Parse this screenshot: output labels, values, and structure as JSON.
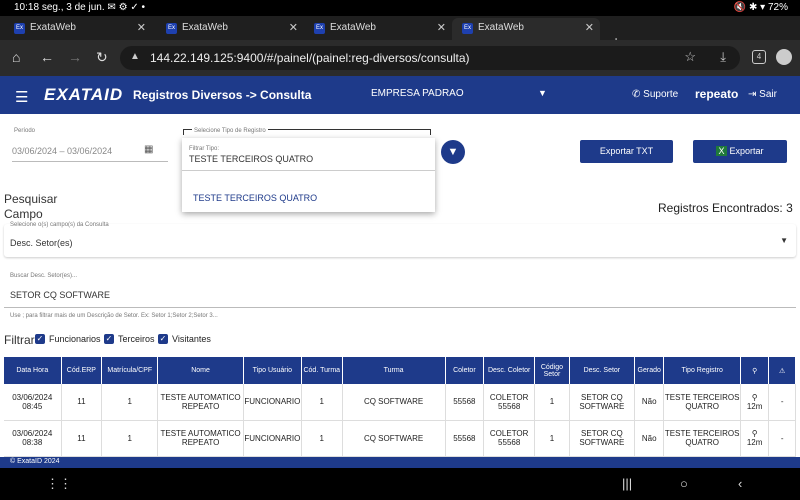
{
  "status": {
    "time": "10:18",
    "date": "seg., 3 de jun.",
    "battery": "72%"
  },
  "browser": {
    "tabs": [
      "ExataWeb",
      "ExataWeb",
      "ExataWeb",
      "ExataWeb"
    ],
    "url": "144.22.149.125:9400/#/painel/(painel:reg-diversos/consulta)",
    "tab_count": "4"
  },
  "app": {
    "logo": "EXATAID",
    "title": "Registros Diversos -> Consulta",
    "company": "EMPRESA PADRAO",
    "support": "Suporte",
    "user": "repeato",
    "logout": "Sair"
  },
  "filters": {
    "period_label": "Período",
    "period_value": "03/06/2024 – 03/06/2024",
    "type_label": "Selecione Tipo de Registro",
    "filter_label": "Filtrar Tipo:",
    "filter_value": "TESTE TERCEIROS QUATRO",
    "option": "TESTE TERCEIROS QUATRO",
    "export_txt": "Exportar TXT",
    "export": "Exportar"
  },
  "search": {
    "pesquisar": "Pesquisar",
    "campo": "Campo",
    "found": "Registros Encontrados: 3",
    "fields_label": "Selecione o(s) campo(s) da Consulta",
    "fields_value": "Desc. Setor(es)",
    "search_label": "Buscar Desc. Setor(es)...",
    "search_value": "SETOR CQ SOFTWARE",
    "hint": "Use ; para filtrar mais de um Descrição de Setor. Ex: Setor 1;Setor 2;Setor 3...",
    "filtrar": "Filtrar",
    "chk1": "Funcionarios",
    "chk2": "Terceiros",
    "chk3": "Visitantes"
  },
  "table": {
    "headers": [
      "Data Hora",
      "Cód.ERP",
      "Matrícula/CPF",
      "Nome",
      "Tipo Usuário",
      "Cód. Turma",
      "Turma",
      "Coletor",
      "Desc. Coletor",
      "Código Setor",
      "Desc. Setor",
      "Gerado",
      "Tipo Registro",
      "",
      ""
    ],
    "rows": [
      [
        "03/06/2024 08:45",
        "11",
        "1",
        "TESTE AUTOMATICO REPEATO",
        "FUNCIONARIO",
        "1",
        "CQ SOFTWARE",
        "55568",
        "COLETOR 55568",
        "1",
        "SETOR CQ SOFTWARE",
        "Não",
        "TESTE TERCEIROS QUATRO",
        "12m",
        "-"
      ],
      [
        "03/06/2024 08:38",
        "11",
        "1",
        "TESTE AUTOMATICO REPEATO",
        "FUNCIONARIO",
        "1",
        "CQ SOFTWARE",
        "55568",
        "COLETOR 55568",
        "1",
        "SETOR CQ SOFTWARE",
        "Não",
        "TESTE TERCEIROS QUATRO",
        "12m",
        "-"
      ]
    ]
  },
  "footer": "© ExataID 2024"
}
